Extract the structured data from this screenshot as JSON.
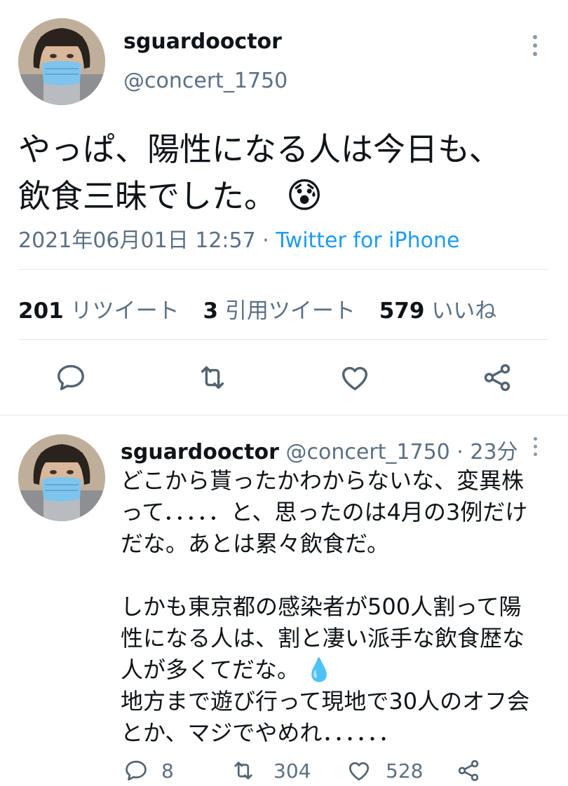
{
  "main_tweet": {
    "display_name": "sguardooctor",
    "handle": "@concert_1750",
    "text_line1": "やっぱ、陽性になる人は今日も、",
    "text_line2": "飲食三昧でした。",
    "emoji": "😰",
    "timestamp": "2021年06月01日 12:57",
    "separator": " · ",
    "source": "Twitter for iPhone",
    "stats": {
      "retweets_count": "201",
      "retweets_label": "リツイート",
      "quotes_count": "3",
      "quotes_label": "引用ツイート",
      "likes_count": "579",
      "likes_label": "いいね"
    },
    "actions": [
      "reply-icon",
      "retweet-icon",
      "like-icon",
      "share-icon"
    ]
  },
  "reply_tweet": {
    "display_name": "sguardooctor",
    "handle": "@concert_1750",
    "separator": " · ",
    "time": "23分",
    "lines": [
      "どこから貰ったかわからないな、変異株",
      "って．．．．．と、思ったのは4月の3例だけ",
      "だな。あとは累々飲食だ。",
      "",
      "しかも東京都の感染者が500人割って陽",
      "性になる人は、割と凄い派手な飲食歴な",
      "人が多くてだな。",
      "地方まで遊び行って現地で30人のオフ会",
      "とか、マジでやめれ．．．．．．"
    ],
    "drop_emoji": "💧",
    "counts": {
      "replies": "8",
      "retweets": "304",
      "likes": "528"
    }
  }
}
